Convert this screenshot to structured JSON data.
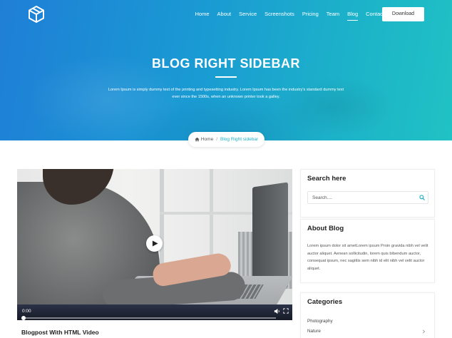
{
  "nav": {
    "items": [
      {
        "label": "Home",
        "active": false
      },
      {
        "label": "About",
        "active": false
      },
      {
        "label": "Service",
        "active": false
      },
      {
        "label": "Screenshots",
        "active": false
      },
      {
        "label": "Pricing",
        "active": false
      },
      {
        "label": "Team",
        "active": false
      },
      {
        "label": "Blog",
        "active": true
      },
      {
        "label": "Contact",
        "active": false
      }
    ],
    "download_label": "Download"
  },
  "hero": {
    "title": "BLOG RIGHT SIDEBAR",
    "subtitle": "Lorem Ipsum is simply dummy text of the printing and typesetting industry. Lorem Ipsum has been the industry's standard dummy text ever since the 1500s, when an unknown printer took a galley."
  },
  "breadcrumb": {
    "home": "Home",
    "separator": "/",
    "current": "Blog Right sidebar"
  },
  "video": {
    "time": "0:00",
    "progress": 0
  },
  "post": {
    "title": "Blogpost With HTML Video"
  },
  "sidebar": {
    "search": {
      "title": "Search here",
      "placeholder": "Search...."
    },
    "about": {
      "title": "About Blog",
      "text": "Lorem ipsum dolor sit ametLorem ipsum Proin gravida nibh vel velit auctor aliquet. Aenean sollicitudin, lorem quis bibendum auctor, consequat ipsum, nec sagittis sem nibh id elit nibh vel velit auctor aliquet."
    },
    "categories": {
      "title": "Categories",
      "items": [
        "Photography",
        "Nature"
      ]
    }
  },
  "colors": {
    "accent": "#1fb3c9",
    "hero_start": "#1f7fd6",
    "hero_end": "#20c2c4"
  },
  "icons": {
    "logo": "cube-logo-icon",
    "home": "home-icon",
    "play": "play-icon",
    "search": "search-icon",
    "chevron": "chevron-right-icon"
  }
}
